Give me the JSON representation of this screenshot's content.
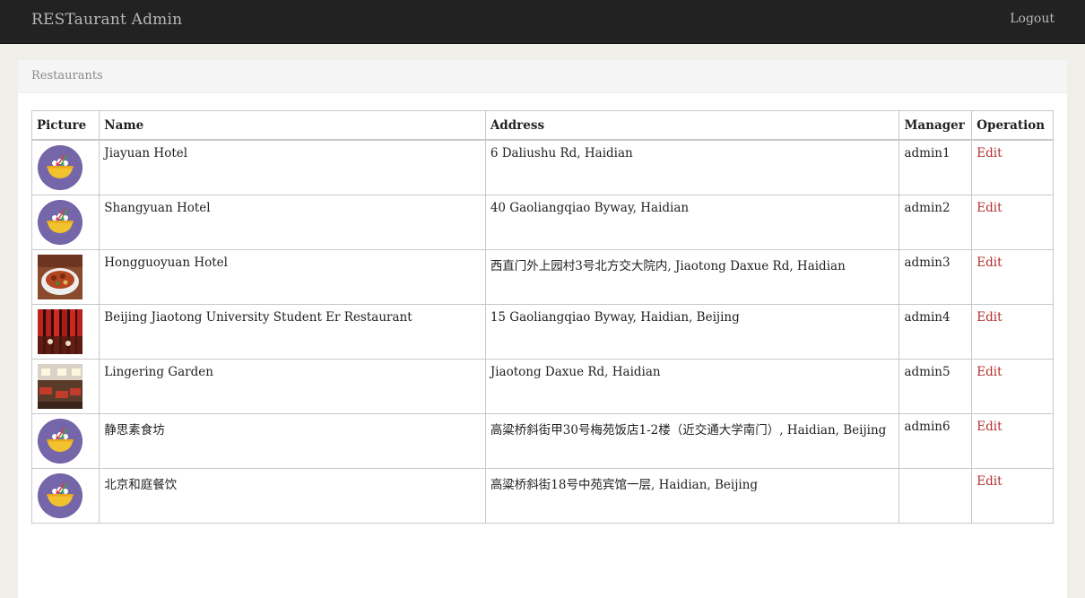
{
  "header": {
    "brand": "RESTaurant Admin",
    "logout": "Logout"
  },
  "panel": {
    "title": "Restaurants"
  },
  "table": {
    "columns": [
      "Picture",
      "Name",
      "Address",
      "Manager",
      "Operation"
    ],
    "rows": [
      {
        "picture": "bowl-icon",
        "name": "Jiayuan Hotel",
        "address": "6 Daliushu Rd, Haidian",
        "manager": "admin1",
        "operation": "Edit"
      },
      {
        "picture": "bowl-icon",
        "name": "Shangyuan Hotel",
        "address": "40 Gaoliangqiao Byway, Haidian",
        "manager": "admin2",
        "operation": "Edit"
      },
      {
        "picture": "food-photo",
        "name": "Hongguoyuan Hotel",
        "address": "西直门外上园村3号北方交大院内, Jiaotong Daxue Rd, Haidian",
        "manager": "admin3",
        "operation": "Edit"
      },
      {
        "picture": "restaurant-photo",
        "name": "Beijing Jiaotong University Student Er Restaurant",
        "address": "15 Gaoliangqiao Byway, Haidian, Beijing",
        "manager": "admin4",
        "operation": "Edit"
      },
      {
        "picture": "dining-hall-photo",
        "name": "Lingering Garden",
        "address": "Jiaotong Daxue Rd, Haidian",
        "manager": "admin5",
        "operation": "Edit"
      },
      {
        "picture": "bowl-icon",
        "name": "静思素食坊",
        "address": "高粱桥斜街甲30号梅苑饭店1-2楼（近交通大学南门）, Haidian, Beijing",
        "manager": "admin6",
        "operation": "Edit"
      },
      {
        "picture": "bowl-icon",
        "name": "北京和庭餐饮",
        "address": "高粱桥斜街18号中苑宾馆一层, Haidian, Beijing",
        "manager": "",
        "operation": "Edit"
      }
    ]
  }
}
